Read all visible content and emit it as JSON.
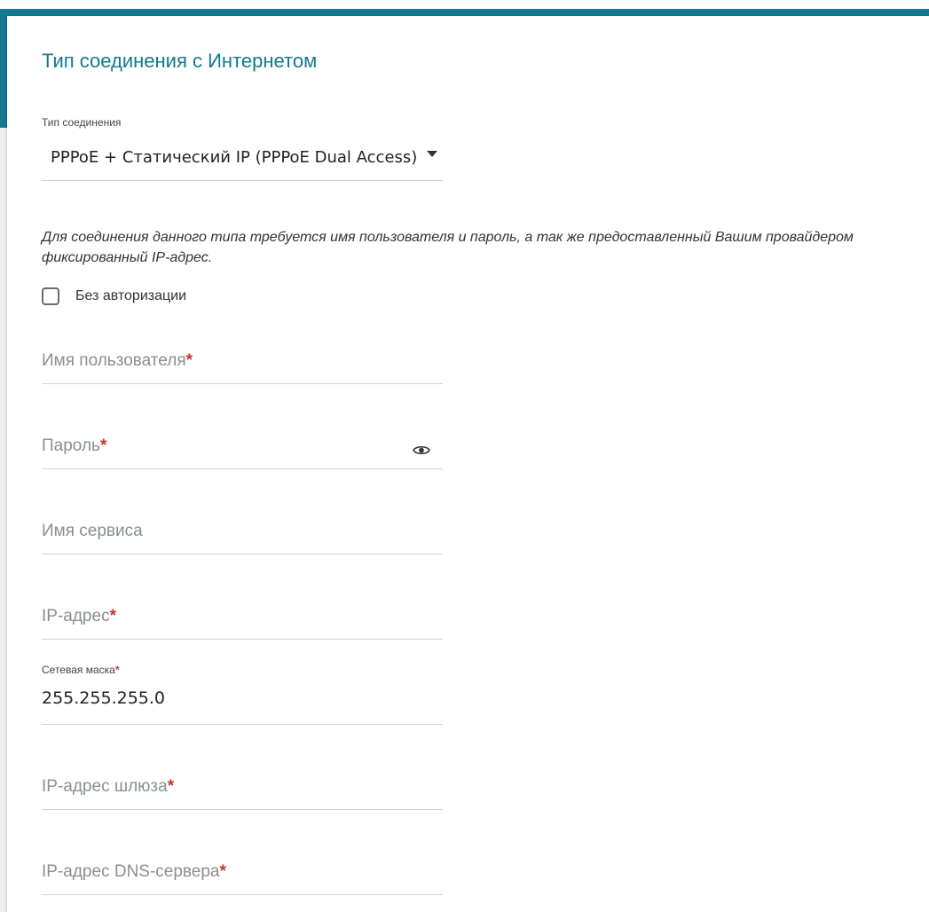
{
  "page": {
    "title": "Тип соединения с Интернетом"
  },
  "connection_type": {
    "label": "Тип соединения",
    "value": "PPPoE + Статический IP (PPPoE Dual Access)"
  },
  "note": "Для соединения данного типа требуется имя пользователя и пароль, а так же предоставленный Вашим провайдером фиксированный IP-адрес.",
  "no_auth": {
    "label": "Без авторизации",
    "checked": false
  },
  "fields": {
    "username": {
      "placeholder": "Имя пользователя",
      "required_mark": "*"
    },
    "password": {
      "placeholder": "Пароль",
      "required_mark": "*",
      "icon": "eye-icon"
    },
    "service_name": {
      "placeholder": "Имя сервиса"
    },
    "ip_address": {
      "placeholder": "IP-адрес",
      "required_mark": "*"
    },
    "netmask": {
      "label": "Сетевая маска",
      "required_mark": "*",
      "value": "255.255.255.0"
    },
    "gateway": {
      "placeholder": "IP-адрес шлюза",
      "required_mark": "*"
    },
    "dns": {
      "placeholder": "IP-адрес DNS-сервера",
      "required_mark": "*"
    }
  },
  "colors": {
    "accent": "#13798f",
    "required": "#c0392b",
    "placeholder": "#8a8f93"
  }
}
